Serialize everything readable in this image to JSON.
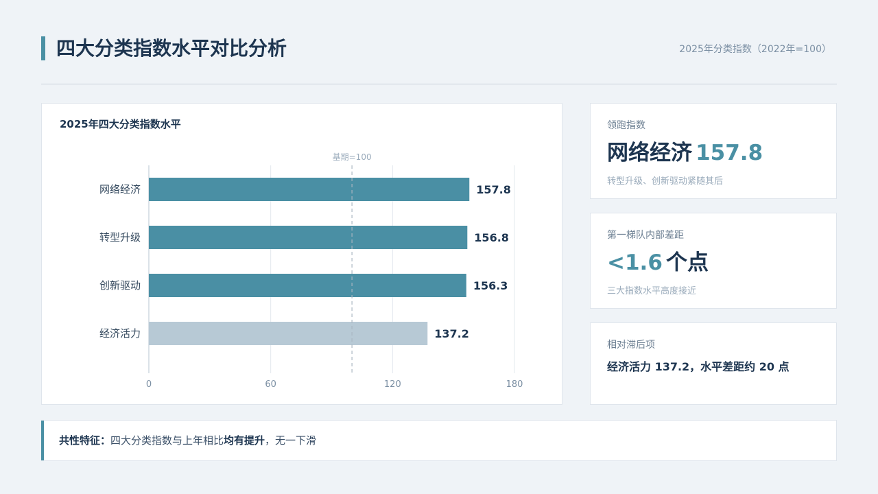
{
  "header": {
    "title": "四大分类指数水平对比分析",
    "subtitle": "2025年分类指数（2022年=100）"
  },
  "chart_card": {
    "title": "2025年四大分类指数水平"
  },
  "chart_data": {
    "type": "bar",
    "orientation": "horizontal",
    "title": "2025年四大分类指数水平",
    "categories": [
      "网络经济",
      "转型升级",
      "创新驱动",
      "经济活力"
    ],
    "values": [
      157.8,
      156.8,
      156.3,
      137.2
    ],
    "value_labels": [
      "157.8",
      "156.8",
      "156.3",
      "137.2"
    ],
    "xlim": [
      0,
      180
    ],
    "xticks": [
      0,
      60,
      120,
      180
    ],
    "xtick_labels": [
      "0",
      "60",
      "120",
      "180"
    ],
    "reference_line": {
      "value": 100,
      "label": "基期=100"
    },
    "grid": true,
    "colors": {
      "primary": "#4a8fa4",
      "secondary": "#b7c9d5"
    },
    "bar_colors": [
      "#4a8fa4",
      "#4a8fa4",
      "#4a8fa4",
      "#b7c9d5"
    ]
  },
  "cards": {
    "leader": {
      "label": "领跑指数",
      "name": "网络经济",
      "value": "157.8",
      "note": "转型升级、创新驱动紧随其后"
    },
    "gap": {
      "label": "第一梯队内部差距",
      "value": "<1.6",
      "unit": "个点",
      "note": "三大指数水平高度接近"
    },
    "lag": {
      "label": "相对滞后项",
      "text": "经济活力 137.2，水平差距约 20 点"
    }
  },
  "footer": {
    "prefix": "共性特征：",
    "part1": "四大分类指数与上年相比",
    "emphasis": "均有提升",
    "part2": "，无一下滑"
  },
  "colors": {
    "accent": "#4a90a4",
    "dark": "#1d3550",
    "background": "#eff3f7"
  }
}
